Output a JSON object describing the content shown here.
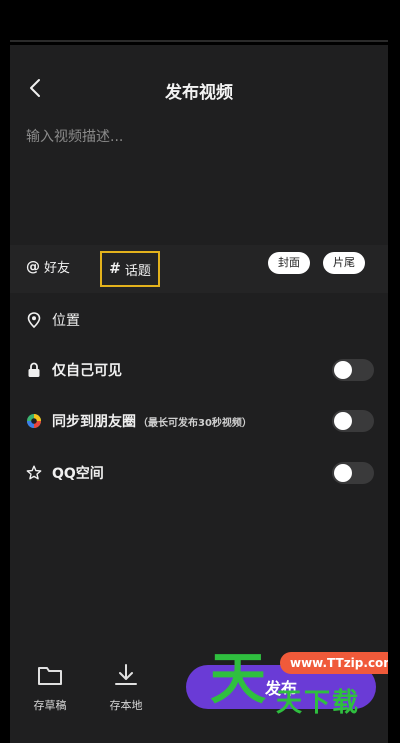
{
  "header": {
    "title": "发布视频",
    "back_icon": "chevron-left-icon"
  },
  "description": {
    "placeholder": "输入视频描述..."
  },
  "tags": {
    "friend_label": "好友",
    "friend_symbol": "@",
    "topic_label": "话题",
    "topic_symbol": "#",
    "cover_label": "封面",
    "tail_label": "片尾"
  },
  "options": {
    "location_label": "位置",
    "private_label": "仅自己可见",
    "moments_label": "同步到朋友圈",
    "moments_note": "（最长可发布30秒视频）",
    "qq_label": "QQ空间"
  },
  "toggles": {
    "private": false,
    "moments": false,
    "qq": false
  },
  "bottom": {
    "draft_label": "存草稿",
    "local_label": "存本地",
    "publish_label": "发布"
  },
  "watermark": {
    "url": "www.TTzip.com",
    "big_char": "天",
    "small_text": "天下载"
  },
  "colors": {
    "accent": "#6a3bd6",
    "highlight_border": "#e3b21c",
    "background": "#1f1f20"
  }
}
